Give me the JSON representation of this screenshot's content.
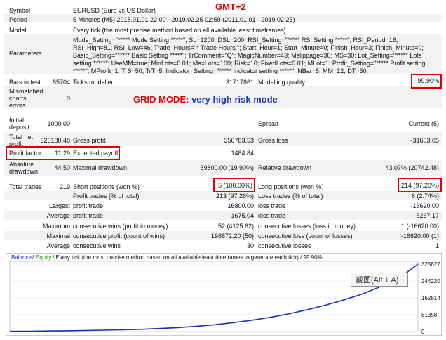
{
  "header": {
    "gmt": "GMT+2",
    "symbol_label": "Symbol",
    "symbol_value": "EURUSD (Euro vs US Dollar)",
    "period_label": "Period",
    "period_value": "5 Minutes (M5) 2018.01.01 22:00 - 2019.02.25 02:59 (2011.01.01 - 2019.02.25)",
    "model_label": "Model",
    "model_value": "Every tick (the most precise method based on all available least timeframes)",
    "params_label": "Parameters",
    "params_value": "Mode_Setting=\"***** Mode Setting *****\"; SL=1200; DSL=200; RSI_Setting=\"***** RSI Setting *****\"; RSI_Period=16; RSI_High=81; RSI_Low=46; Trade_Hours=\"* Trade Hours:\"; Start_Hour=1; Start_Minute=0; Finish_Hour=3; Finish_Minute=0; Basic_Setting=\"***** Basic Setting *****\"; TrComment=\"Q\"; MagicNumber=43; Mslippage=30; MS=30; Lot_Setting=\"***** Lots setting *****\"; UseMM=true; MinLots=0.01; MaxLots=100; Risk=10; FixedLots=0.01; MLot=1; Profit_Setting=\"***** Profit setting *****\"; MProfit=1; TrS=50; TrT=5; Indicator_Setting=\"***** Indicator setting *****\"; NBar=5; MM=12; DT=50;"
  },
  "bars": {
    "bars_label": "Bars in test",
    "bars_value": "85704",
    "ticks_label": "Ticks modelled",
    "ticks_value": "31717861",
    "quality_label": "Modelling quality",
    "quality_value": "99.90%",
    "mismatch_label_1": "Mismatched",
    "mismatch_label_2": "charts",
    "mismatch_label_3": "errors",
    "mismatch_value": "0"
  },
  "banner": {
    "grid_red": "GRID MODE:",
    "grid_blue": "very high risk mode"
  },
  "results": {
    "initial_label_1": "Initial",
    "initial_label_2": "deposit",
    "initial_value": "1000.00",
    "spread_label": "Spread",
    "spread_value": "Current (5)",
    "net_label_1": "Total net",
    "net_label_2": "profit",
    "net_value": "325180.48",
    "gross_profit_label": "Gross profit",
    "gross_profit_value": "356783.53",
    "gross_loss_label": "Gross loss",
    "gross_loss_value": "-31603.05",
    "pf_label": "Profit factor",
    "pf_value": "11.29",
    "payoff_label": "Expected payoff",
    "payoff_value": "1484.84",
    "abs_dd_label_1": "Absolute",
    "abs_dd_label_2": "drawdown",
    "abs_dd_value": "44.50",
    "max_dd_label": "Maximal drawdown",
    "max_dd_value": "59800.00 (19.90%)",
    "rel_dd_label": "Relative drawdown",
    "rel_dd_value": "43.07% (20742.48)",
    "trades_label": "Total trades",
    "trades_value": "219",
    "short_label": "Short positions (won %)",
    "short_value": "5 (100.00%)",
    "long_label": "Long positions (won %)",
    "long_value": "214 (97.20%)",
    "ptrades_label": "Profit trades (% of total)",
    "ptrades_value": "213 (97.26%)",
    "ltrades_label": "Loss trades (% of total)",
    "ltrades_value": "6 (2.74%)",
    "largest_label": "Largest",
    "lpt_label": "profit trade",
    "lpt_value": "16800.00",
    "llt_label": "loss trade",
    "llt_value": "-16620.00",
    "average_label": "Average",
    "apt_label": "profit trade",
    "apt_value": "1675.04",
    "alt_label": "loss trade",
    "alt_value": "-5267.17",
    "maximum_label": "Maximum",
    "mcw_label": "consecutive wins (profit in money)",
    "mcw_value": "52 (4125.62)",
    "mcl_label": "consecutive losses (loss in money)",
    "mcl_value": "1 (-16620.00)",
    "maximal_label": "Maximal",
    "mcp_label": "consecutive profit (count of wins)",
    "mcp_value": "198872.20 (50)",
    "mcll_label": "consecutive loss (count of losses)",
    "mcll_value": "-16620.00 (1)",
    "avg2_label": "Average",
    "acw_label": "consecutive wins",
    "acw_value": "30",
    "acl_label": "consecutive losses",
    "acl_value": "1"
  },
  "chart_header": {
    "balance": "Balance",
    "sep": "/",
    "equity": "Equity",
    "rest": "/ Every tick (the most precise method based on all available least timeframes to generate each tick) / 99.90%"
  },
  "tooltip": "截图(Alt + A)",
  "colors": {
    "balance_line": "#1a2fbf",
    "equity_label": "#1a9a1a",
    "highlight": "#e00000",
    "grid_blue": "#1f3cc9"
  },
  "chart_data": {
    "type": "line",
    "title": "",
    "xlabel": "",
    "ylabel": "",
    "y_ticks": [
      0,
      81358,
      162814,
      244220,
      325627
    ],
    "ylim": [
      0,
      325627
    ],
    "series": [
      {
        "name": "Balance",
        "x": [
          0,
          10,
          20,
          30,
          40,
          50,
          60,
          70,
          80,
          90,
          100,
          110,
          120,
          130,
          140,
          150,
          160,
          170,
          180,
          190,
          200,
          210,
          219
        ],
        "values": [
          1000,
          1800,
          2800,
          3900,
          5200,
          6800,
          8600,
          11000,
          14500,
          19000,
          25000,
          33000,
          43000,
          55000,
          69000,
          86000,
          106000,
          129000,
          155000,
          184000,
          221000,
          266000,
          325627
        ]
      }
    ]
  }
}
